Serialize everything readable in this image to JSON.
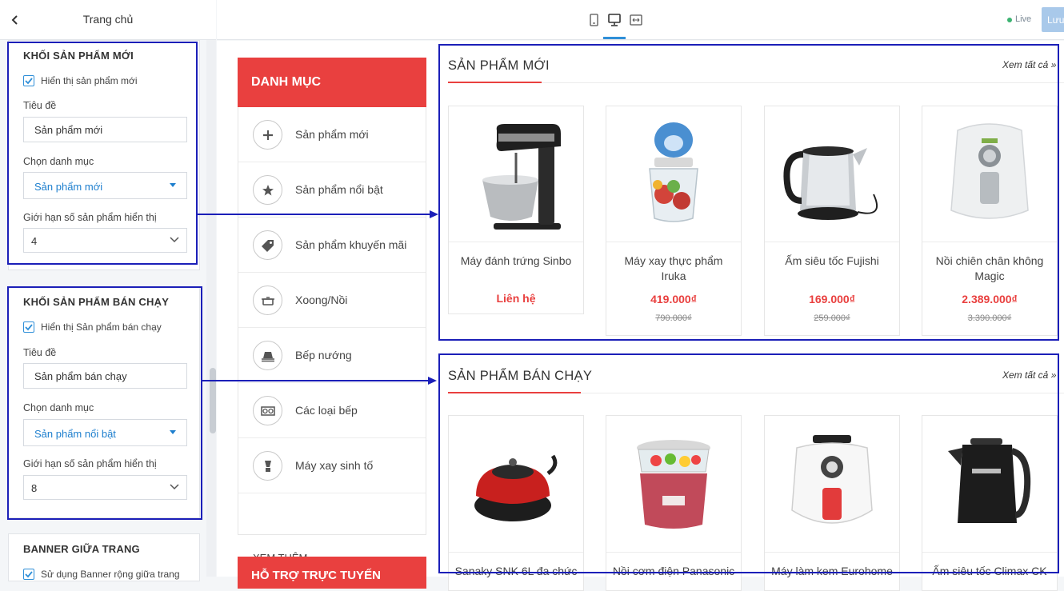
{
  "sidebar": {
    "title": "Trang chủ",
    "new_block": {
      "heading": "KHỐI SẢN PHẨM MỚI",
      "show_label": "Hiển thị sản phẩm mới",
      "title_label": "Tiêu đề",
      "title_value": "Sản phẩm mới",
      "category_label": "Chọn danh mục",
      "category_value": "Sản phẩm mới",
      "limit_label": "Giới hạn số sản phẩm hiển thị",
      "limit_value": "4"
    },
    "best_block": {
      "heading": "KHỐI SẢN PHẨM BÁN CHẠY",
      "show_label": "Hiển thị Sản phẩm bán chạy",
      "title_label": "Tiêu đề",
      "title_value": "Sản phẩm bán chạy",
      "category_label": "Chọn danh mục",
      "category_value": "Sản phẩm nổi bật",
      "limit_label": "Giới hạn số sản phẩm hiển thị",
      "limit_value": "8"
    },
    "banner_block": {
      "heading": "BANNER GIỮA TRANG",
      "use_label": "Sử dụng Banner rộng giữa trang"
    }
  },
  "topbar": {
    "live_label": "Live",
    "save_label": "Lưu"
  },
  "categories": {
    "header": "DANH MỤC",
    "items": [
      {
        "label": "Sản phẩm mới",
        "icon": "plus-icon"
      },
      {
        "label": "Sản phẩm nổi bật",
        "icon": "star-icon"
      },
      {
        "label": "Sản phẩm khuyến mãi",
        "icon": "tag-icon"
      },
      {
        "label": "Xoong/Nồi",
        "icon": "pot-icon"
      },
      {
        "label": "Bếp nướng",
        "icon": "grill-icon"
      },
      {
        "label": "Các loại bếp",
        "icon": "stove-icon"
      },
      {
        "label": "Máy xay sinh tố",
        "icon": "blender-icon"
      }
    ],
    "more": "XEM THÊM",
    "support": "HỖ TRỢ TRỰC TUYẾN"
  },
  "new_products": {
    "title": "SẢN PHẨM MỚI",
    "see_all": "Xem tất cả »",
    "items": [
      {
        "name": "Máy đánh trứng Sinbo",
        "price": "Liên hệ",
        "old_price": ""
      },
      {
        "name": "Máy xay thực phẩm Iruka",
        "price": "419.000₫",
        "old_price": "790.000₫"
      },
      {
        "name": "Ấm siêu tốc Fujishi",
        "price": "169.000₫",
        "old_price": "259.000₫"
      },
      {
        "name": "Nồi chiên chân không Magic",
        "price": "2.389.000₫",
        "old_price": "3.390.000₫"
      }
    ]
  },
  "best_products": {
    "title": "SẢN PHẨM BÁN CHẠY",
    "see_all": "Xem tất cả »",
    "items": [
      {
        "name": "Sanaky SNK 6L đa chức"
      },
      {
        "name": "Nồi cơm điện Panasonic"
      },
      {
        "name": "Máy làm kem Eurohome"
      },
      {
        "name": "Ấm siêu tốc Climax CK"
      }
    ]
  },
  "colors": {
    "accent_red": "#e9403f",
    "highlight_blue": "#1b1fb8",
    "link_blue": "#1e7fce"
  }
}
